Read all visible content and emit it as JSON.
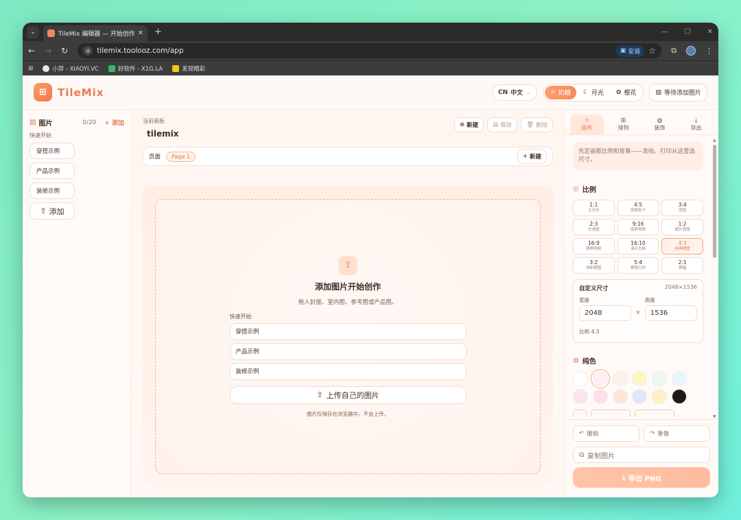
{
  "browser": {
    "tab_title": "TileMix 编辑器 — 开始创作",
    "url": "tilemix.toolooz.com/app",
    "install_label": "安装",
    "bookmarks": [
      {
        "label": "小羿 - XIAOYI.VC",
        "color": "#e8e8e8"
      },
      {
        "label": "好软件 - X1G.LA",
        "color": "#39b56a"
      },
      {
        "label": "发现精彩",
        "color": "#f5c518"
      }
    ]
  },
  "header": {
    "brand": "TileMix",
    "lang": "中文",
    "lang_code": "CN",
    "themes": [
      "奶糖",
      "月光",
      "樱花"
    ],
    "active_theme": "奶糖",
    "waiting_label": "等待添加图片",
    "accent": "#f08a5c"
  },
  "left": {
    "title": "图片",
    "count": "0/20",
    "add": "添加",
    "quick_start": "快速开始",
    "examples": [
      "穿搭示例",
      "产品示例",
      "装修示例"
    ],
    "upload": "添加"
  },
  "center": {
    "current_label": "当前画板",
    "board_name": "tilemix",
    "new_label": "新建",
    "save_label": "保存",
    "delete_label": "删除",
    "page_label": "页面",
    "page_tag": "Page 1",
    "page_new": "新建",
    "drop_title": "添加图片开始创作",
    "drop_sub": "拖入封面、室内图、参考图或产品图。",
    "quick_start": "快速开始",
    "examples": [
      "穿搭示例",
      "产品示例",
      "装修示例"
    ],
    "upload_own": "上传自己的图片",
    "note": "图片仅保存在浏览器中，不会上传。"
  },
  "right": {
    "tabs": [
      "画布",
      "排列",
      "装饰",
      "导出"
    ],
    "active_tab": "画布",
    "info": "先定画板比例和背景——发帖、打印从这里选尺寸。",
    "ratio_title": "比例",
    "ratios": [
      {
        "r": "1:1",
        "s": "正方形"
      },
      {
        "r": "4:5",
        "s": "竖版帖子"
      },
      {
        "r": "3:4",
        "s": "竖图"
      },
      {
        "r": "2:3",
        "s": "长竖图"
      },
      {
        "r": "9:16",
        "s": "竖屏视频"
      },
      {
        "r": "1:2",
        "s": "超长竖图"
      },
      {
        "r": "16:9",
        "s": "横屏视频"
      },
      {
        "r": "16:10",
        "s": "演示文稿"
      },
      {
        "r": "4:3",
        "s": "经典横图"
      },
      {
        "r": "3:2",
        "s": "相机横图"
      },
      {
        "r": "5:4",
        "s": "横版打印"
      },
      {
        "r": "2:1",
        "s": "横幅"
      }
    ],
    "active_ratio": "4:3",
    "custom_title": "自定义尺寸",
    "custom_dims": "2048×1536",
    "width_label": "宽度",
    "height_label": "高度",
    "width": "2048",
    "height": "1536",
    "ratio_text": "比例 4:3",
    "color_title": "纯色",
    "colors": [
      "#ffffff",
      "#fdeef0",
      "#fcf0ea",
      "#fdf6c4",
      "#eaf8ee",
      "#e8f6fa",
      "#fde3ee",
      "#fde0e6",
      "#fde6d4",
      "#dde7fa",
      "#fdf0c4",
      "#1f1a18"
    ],
    "active_color": "#fdeef0",
    "undo": "撤销",
    "redo": "重做",
    "copy": "复制图片",
    "export": "导出 PNG"
  }
}
